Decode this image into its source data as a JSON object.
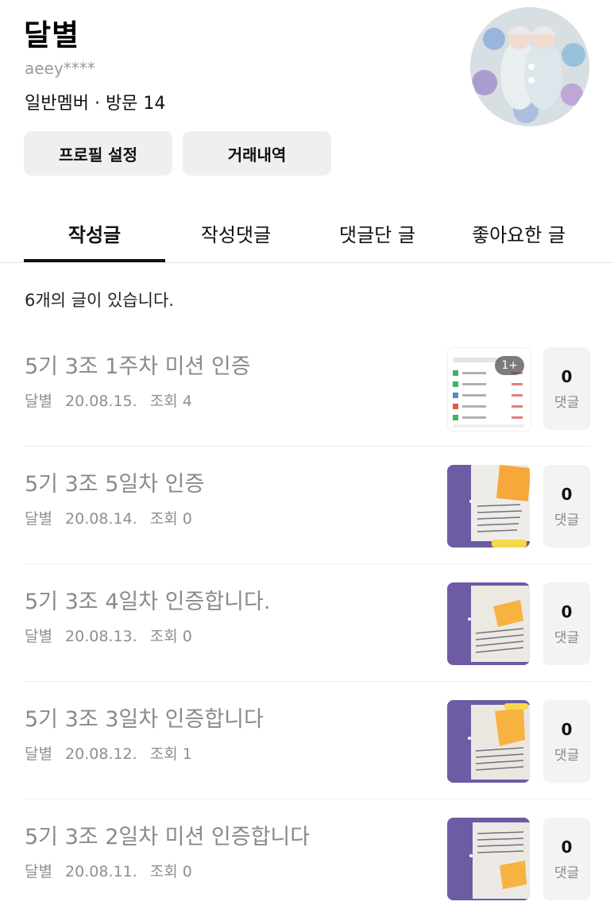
{
  "profile": {
    "nickname": "달별",
    "user_id": "aeey****",
    "meta": "일반멤버 · 방문 14",
    "buttons": {
      "profile_settings": "프로필 설정",
      "transactions": "거래내역"
    }
  },
  "tabs": [
    {
      "label": "작성글",
      "active": true
    },
    {
      "label": "작성댓글",
      "active": false
    },
    {
      "label": "댓글단 글",
      "active": false
    },
    {
      "label": "좋아요한 글",
      "active": false
    }
  ],
  "post_count_text": "6개의 글이 있습니다.",
  "posts": [
    {
      "title": "5기 3조 1주차 미션 인증",
      "author": "달별",
      "date": "20.08.15.",
      "views": "조회 4",
      "comments": "0",
      "comment_label": "댓글",
      "thumb_badge": "1+"
    },
    {
      "title": "5기 3조 5일차 인증",
      "author": "달별",
      "date": "20.08.14.",
      "views": "조회 0",
      "comments": "0",
      "comment_label": "댓글"
    },
    {
      "title": "5기 3조 4일차 인증합니다.",
      "author": "달별",
      "date": "20.08.13.",
      "views": "조회 0",
      "comments": "0",
      "comment_label": "댓글"
    },
    {
      "title": "5기 3조 3일차 인증합니다",
      "author": "달별",
      "date": "20.08.12.",
      "views": "조회 1",
      "comments": "0",
      "comment_label": "댓글"
    },
    {
      "title": "5기 3조 2일차 미션 인증합니다",
      "author": "달별",
      "date": "20.08.11.",
      "views": "조회 0",
      "comments": "0",
      "comment_label": "댓글"
    }
  ],
  "colors": {
    "thumb_purple": "#6d5ba3",
    "tab_active": "#111111",
    "button_bg": "#efeff2"
  }
}
